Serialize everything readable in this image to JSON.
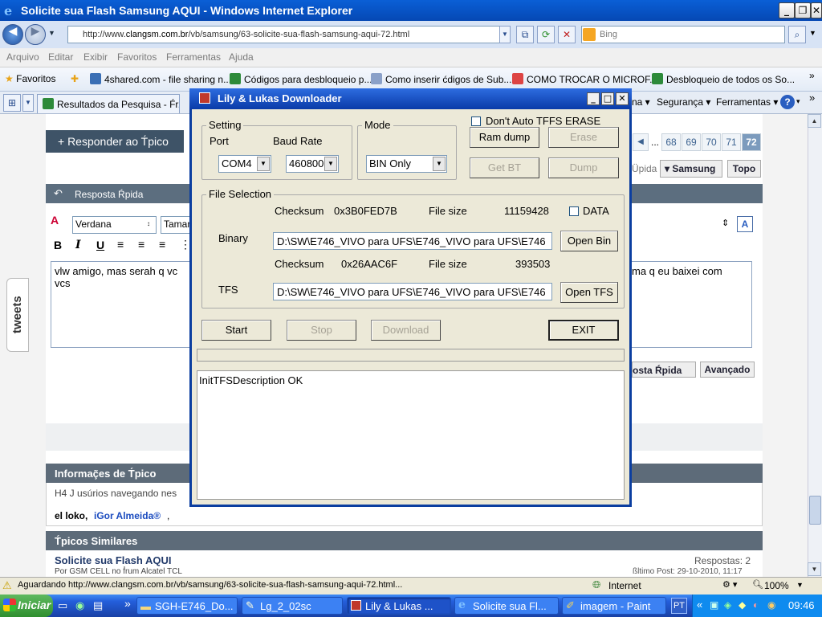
{
  "browser": {
    "title": "Solicite sua Flash Samsung AQUI - Windows Internet Explorer",
    "url_prefix": "http://www.",
    "url_domain": "clangsm.com.br",
    "url_path": "/vb/samsung/63-solicite-sua-flash-samsung-aqui-72.html",
    "search_placeholder": "Bing",
    "menu": [
      "Arquivo",
      "Editar",
      "Exibir",
      "Favoritos",
      "Ferramentas",
      "Ajuda"
    ],
    "favorites_label": "Favoritos",
    "favorites": [
      "4shared.com - file sharing n...",
      "Códigos para desbloqueio p...",
      "Como inserir ćdigos de Sub...",
      "COMO TROCAR O MICROF...",
      "Desbloqueio de todos os So..."
    ],
    "tab": "Resultados da Pesquisa - F́r...",
    "tab_right": [
      "na ▾",
      "Segurança ▾",
      "Ferramentas ▾"
    ],
    "help_icon": "help-icon"
  },
  "webpage": {
    "reply_button": "+ Responder ao T́pico",
    "pages": [
      "...",
      "68",
      "69",
      "70",
      "71",
      "72"
    ],
    "quick_reply_trunc": "Üpida",
    "samsung_btn": "Samsung",
    "top_btn": "Topo",
    "quick_reply_header": "Resposta Ŕpida",
    "font_name": "Verdana",
    "font_size": "Taman",
    "editor_text_left": "vlw amigo, mas serah q vc",
    "editor_text_left2": "vcs",
    "editor_text_right": "ma q eu baixei com",
    "post_quick_reply": "osta Ŕpida",
    "advanced": "Avançado",
    "tweets": "tweets",
    "info_header": "Informaç̃es de T́pico",
    "info_line": "H4 J usúrios navegando nes",
    "users_prefix": "el loko,",
    "users_name": "iGor Almeida®",
    "users_suffix": ",",
    "similar_header": "T́picos Similares",
    "similar_title": "Solicite sua Flash AQUI",
    "similar_sub": "Por GSM CELL no f́rum Alcatel TCL",
    "replies": "Respostas: 2",
    "last_post": "ßltimo Post: 29-10-2010, 11:17"
  },
  "dialog": {
    "title": "Lily & Lukas Downloader",
    "setting_group": "Setting",
    "port_label": "Port",
    "baud_label": "Baud Rate",
    "port_value": "COM4",
    "baud_value": "460800",
    "mode_group": "Mode",
    "mode_value": "BIN Only",
    "no_tffs_label": "Don't Auto TFFS ERASE",
    "ram_dump": "Ram dump",
    "erase": "Erase",
    "get_bt": "Get BT",
    "dump": "Dump",
    "file_group": "File Selection",
    "checksum_label": "Checksum",
    "checksum_bin": "0x3B0FED7B",
    "filesize_label": "File size",
    "filesize_bin": "11159428",
    "data_label": "DATA",
    "binary_label": "Binary",
    "binary_path": "D:\\SW\\E746_VIVO para UFS\\E746_VIVO para UFS\\E746",
    "open_bin": "Open Bin",
    "checksum_tfs": "0x26AAC6F",
    "filesize_tfs": "393503",
    "tfs_label": "TFS",
    "tfs_path": "D:\\SW\\E746_VIVO para UFS\\E746_VIVO para UFS\\E746",
    "open_tfs": "Open TFS",
    "start": "Start",
    "stop": "Stop",
    "download": "Download",
    "exit": "EXIT",
    "log": "InitTFSDescription OK",
    "progress": 0
  },
  "status": {
    "text": "Aguardando http://www.clangsm.com.br/vb/samsung/63-solicite-sua-flash-samsung-aqui-72.html...",
    "zone": "Internet",
    "zoom": "100%"
  },
  "taskbar": {
    "start": "Iniciar",
    "tasks": [
      "SGH-E746_Do...",
      "Lg_2_02sc",
      "Lily & Lukas ...",
      "Solicite sua Fl...",
      "imagem - Paint"
    ],
    "lang": "PT",
    "clock": "09:46"
  }
}
